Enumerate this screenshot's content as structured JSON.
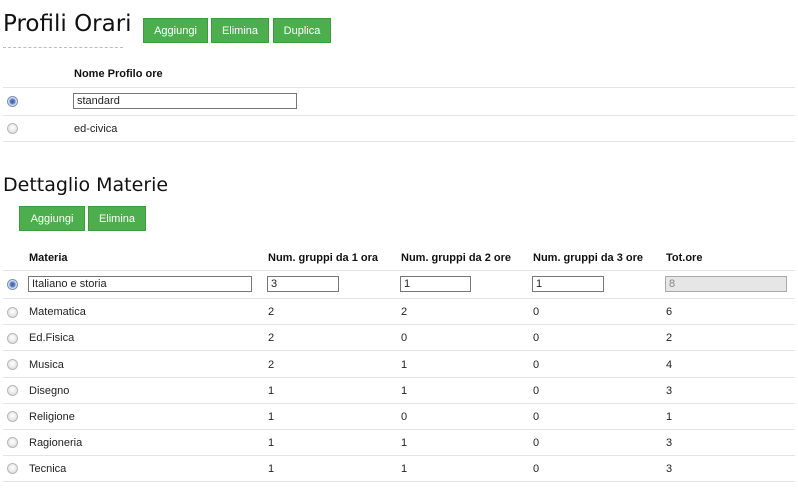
{
  "profiles_section": {
    "title": "Profili Orari",
    "buttons": {
      "add": "Aggiungi",
      "delete": "Elimina",
      "duplicate": "Duplica"
    },
    "column_header": "Nome Profilo ore",
    "rows": [
      {
        "name": "standard",
        "selected": true
      },
      {
        "name": "ed-civica",
        "selected": false
      }
    ]
  },
  "subjects_section": {
    "title": "Dettaglio Materie",
    "buttons": {
      "add": "Aggiungi",
      "delete": "Elimina"
    },
    "headers": [
      "Materia",
      "Num. gruppi da 1 ora",
      "Num. gruppi da 2 ore",
      "Num. gruppi da 3 ore",
      "Tot.ore"
    ],
    "rows": [
      {
        "materia": "Italiano e storia",
        "g1": "3",
        "g2": "1",
        "g3": "1",
        "tot": "8",
        "selected": true
      },
      {
        "materia": "Matematica",
        "g1": "2",
        "g2": "2",
        "g3": "0",
        "tot": "6",
        "selected": false
      },
      {
        "materia": "Ed.Fisica",
        "g1": "2",
        "g2": "0",
        "g3": "0",
        "tot": "2",
        "selected": false
      },
      {
        "materia": "Musica",
        "g1": "2",
        "g2": "1",
        "g3": "0",
        "tot": "4",
        "selected": false
      },
      {
        "materia": "Disegno",
        "g1": "1",
        "g2": "1",
        "g3": "0",
        "tot": "3",
        "selected": false
      },
      {
        "materia": "Religione",
        "g1": "1",
        "g2": "0",
        "g3": "0",
        "tot": "1",
        "selected": false
      },
      {
        "materia": "Ragioneria",
        "g1": "1",
        "g2": "1",
        "g3": "0",
        "tot": "3",
        "selected": false
      },
      {
        "materia": "Tecnica",
        "g1": "1",
        "g2": "1",
        "g3": "0",
        "tot": "3",
        "selected": false
      }
    ]
  },
  "colors": {
    "button_bg": "#4cae4c",
    "button_text": "#ffffff",
    "radio_selected": "#3c5fa6"
  }
}
